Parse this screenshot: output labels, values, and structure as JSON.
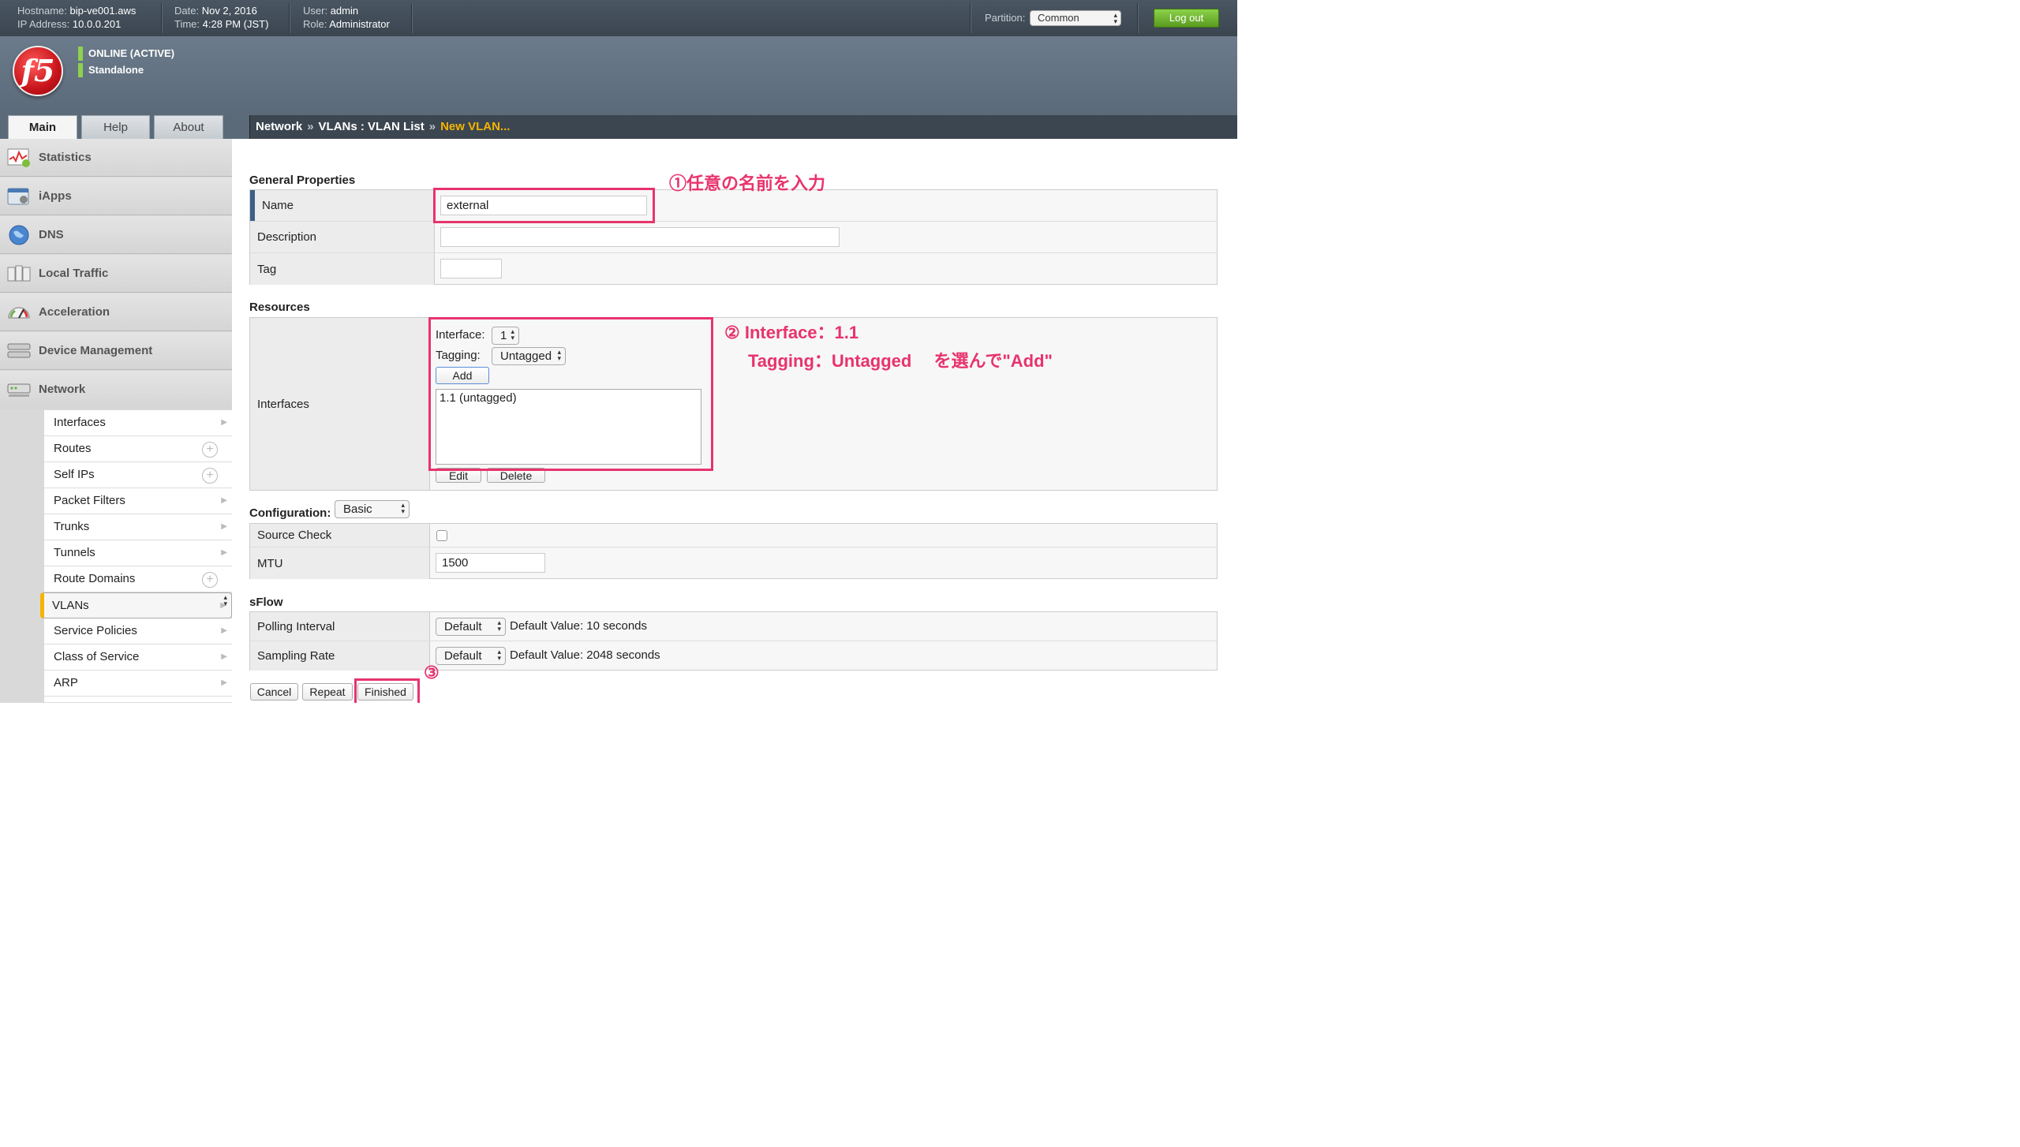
{
  "header": {
    "hostname_label": "Hostname:",
    "hostname": "bip-ve001.aws",
    "ip_label": "IP Address:",
    "ip": "10.0.0.201",
    "date_label": "Date:",
    "date": "Nov 2, 2016",
    "time_label": "Time:",
    "time": "4:28 PM (JST)",
    "user_label": "User:",
    "user": "admin",
    "role_label": "Role:",
    "role": "Administrator",
    "partition_label": "Partition:",
    "partition_value": "Common",
    "logout_label": "Log out"
  },
  "banner": {
    "logo_text": "f5",
    "status_1": "ONLINE (ACTIVE)",
    "status_2": "Standalone"
  },
  "tabs": [
    "Main",
    "Help",
    "About"
  ],
  "breadcrumb": {
    "part1": "Network",
    "sep": "»",
    "part2": "VLANs : VLAN List",
    "part3": "New VLAN..."
  },
  "sidebar": {
    "items": [
      "Statistics",
      "iApps",
      "DNS",
      "Local Traffic",
      "Acceleration",
      "Device Management",
      "Network"
    ],
    "sub_items": [
      "Interfaces",
      "Routes",
      "Self IPs",
      "Packet Filters",
      "Trunks",
      "Tunnels",
      "Route Domains",
      "VLANs",
      "Service Policies",
      "Class of Service",
      "ARP"
    ]
  },
  "general": {
    "title": "General Properties",
    "name_label": "Name",
    "name_value": "external",
    "description_label": "Description",
    "description_value": "",
    "tag_label": "Tag",
    "tag_value": ""
  },
  "resources": {
    "title": "Resources",
    "interfaces_label": "Interfaces",
    "interface_label": "Interface:",
    "interface_value": "1",
    "tagging_label": "Tagging:",
    "tagging_value": "Untagged",
    "add_label": "Add",
    "list_item": "1.1 (untagged)",
    "edit_label": "Edit",
    "delete_label": "Delete"
  },
  "configuration": {
    "title": "Configuration:",
    "mode": "Basic",
    "source_check_label": "Source Check",
    "mtu_label": "MTU",
    "mtu_value": "1500"
  },
  "sflow": {
    "title": "sFlow",
    "polling_label": "Polling Interval",
    "polling_value": "Default",
    "polling_note": "Default Value: 10 seconds",
    "sampling_label": "Sampling Rate",
    "sampling_value": "Default",
    "sampling_note": "Default Value: 2048 seconds"
  },
  "actions": {
    "cancel": "Cancel",
    "repeat": "Repeat",
    "finished": "Finished"
  },
  "annotations": {
    "a1": "①任意の名前を入力",
    "a2_line1": "② Interface：1.1",
    "a2_line2": "Tagging：Untagged 　を選んで\"Add\"",
    "a3": "③",
    "color": "#e8336d"
  }
}
